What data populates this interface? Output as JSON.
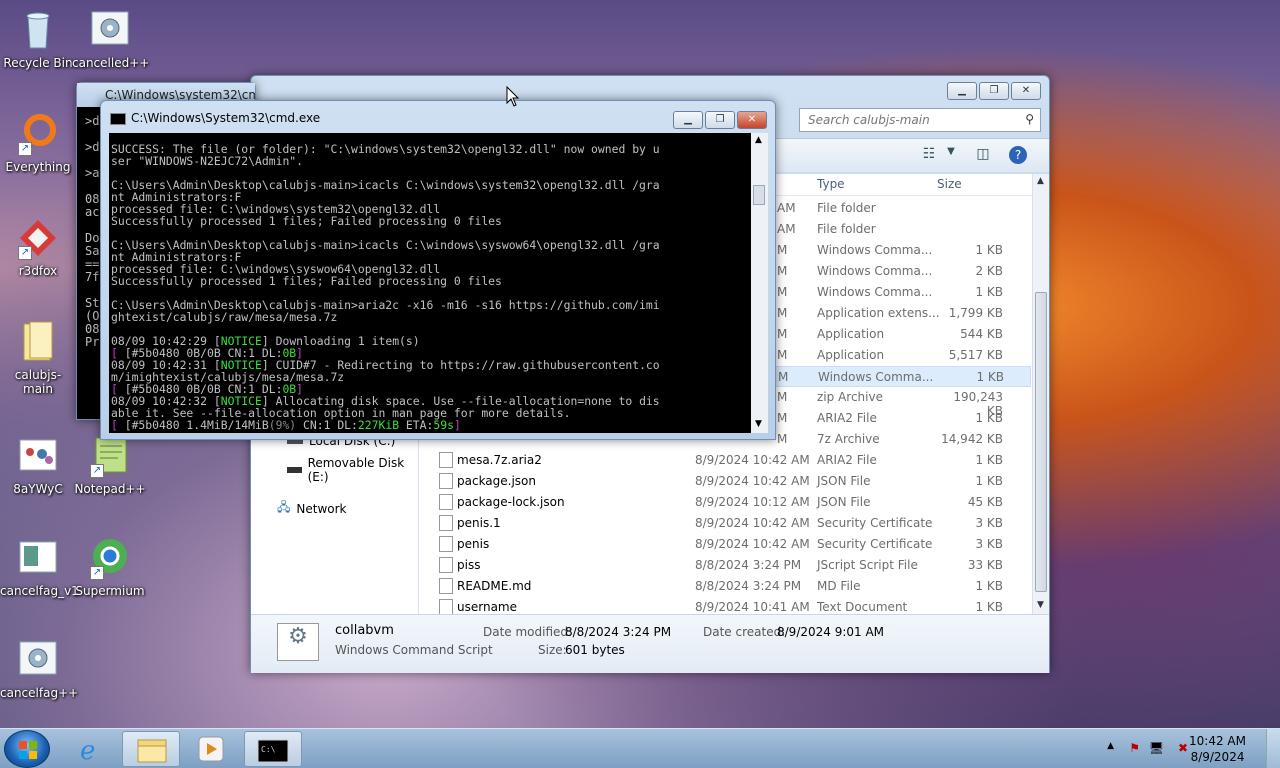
{
  "desktop": {
    "icons": [
      {
        "label": "Recycle Bin"
      },
      {
        "label": "cancelled++"
      },
      {
        "label": "Everything"
      },
      {
        "label": "r3dfox"
      },
      {
        "label": "calubjs-main"
      },
      {
        "label": "8aYWyC"
      },
      {
        "label": "Notepad++"
      },
      {
        "label": "cancelfag_v1"
      },
      {
        "label": "Supermium"
      },
      {
        "label": "cancelfag++"
      }
    ]
  },
  "cmd_back": {
    "title": "C:\\Windows\\system32\\cmd",
    "lines": [
      ">d",
      "",
      ">d",
      "",
      ">a",
      "",
      "08",
      "ac",
      "",
      "Do",
      "Sa",
      "==",
      "7f",
      "",
      "St",
      "(O",
      "08",
      "Pr"
    ]
  },
  "cmd_front": {
    "title": "C:\\Windows\\System32\\cmd.exe",
    "line1": "SUCCESS: The file (or folder): \"C:\\windows\\system32\\opengl32.dll\" now owned by u",
    "line2": "ser \"WINDOWS-N2EJC72\\Admin\".",
    "line3": "C:\\Users\\Admin\\Desktop\\calubjs-main>icacls C:\\windows\\system32\\opengl32.dll /gra",
    "line4": "nt Administrators:F",
    "line5": "processed file: C:\\windows\\system32\\opengl32.dll",
    "line6": "Successfully processed 1 files; Failed processing 0 files",
    "line7": "C:\\Users\\Admin\\Desktop\\calubjs-main>icacls C:\\windows\\syswow64\\opengl32.dll /gra",
    "line8": "nt Administrators:F",
    "line9": "processed file: C:\\windows\\syswow64\\opengl32.dll",
    "line10": "Successfully processed 1 files; Failed processing 0 files",
    "line11": "C:\\Users\\Admin\\Desktop\\calubjs-main>aria2c -x16 -m16 -s16 https://github.com/imi",
    "line12": "ghtexist/calubjs/raw/mesa/mesa.7z",
    "l13a": "08/09 10:42:29 [",
    "notice": "NOTICE",
    "l13b": "] Downloading 1 item(s)",
    "l14a": " [#5b0480 0B/0B CN:1 DL:",
    "l14b": "0B",
    "l14c": "]",
    "l15a": "08/09 10:42:31 [",
    "l15b": "] CUID#7 - Redirecting to https://raw.githubusercontent.co",
    "line16": "m/imightexist/calubjs/mesa/mesa.7z",
    "l17a": " [#5b0480 0B/0B CN:1 DL:",
    "l17b": "0B",
    "l17c": "]",
    "l18a": "08/09 10:42:32 [",
    "l18b": "] Allocating disk space. Use --file-allocation=none to dis",
    "line19": "able it. See --file-allocation option in man page for more details.",
    "l20a": " [#5b0480 1.4MiB/14MiB",
    "l20b": "(9%)",
    "l20c": " CN:1 DL:",
    "l20d": "227KiB",
    "l20e": " ETA:",
    "l20f": "59s",
    "l20g": "]"
  },
  "explorer": {
    "search_placeholder": "Search calubjs-main",
    "columns": {
      "type": "Type",
      "size": "Size"
    },
    "nav": {
      "local_disk": "Local Disk (C:)",
      "removable": "Removable Disk (E:)",
      "network": "Network"
    },
    "rows_partial": [
      {
        "type": "File folder",
        "size": "",
        "dt": "AM"
      },
      {
        "type": "File folder",
        "size": "",
        "dt": "AM"
      },
      {
        "type": "Windows Comma...",
        "size": "1 KB",
        "dt": "M"
      },
      {
        "type": "Windows Comma...",
        "size": "2 KB",
        "dt": "M"
      },
      {
        "type": "Windows Comma...",
        "size": "1 KB",
        "dt": "M"
      },
      {
        "type": "Application extens...",
        "size": "1,799 KB",
        "dt": "M"
      },
      {
        "type": "Application",
        "size": "544 KB",
        "dt": "M"
      },
      {
        "type": "Application",
        "size": "5,517 KB",
        "dt": "M"
      },
      {
        "type": "Windows Comma...",
        "size": "1 KB",
        "dt": "M"
      },
      {
        "type": "zip Archive",
        "size": "190,243 KB",
        "dt": "M"
      },
      {
        "type": "ARIA2 File",
        "size": "1 KB",
        "dt": "M"
      },
      {
        "type": "7z Archive",
        "size": "14,942 KB",
        "dt": "M"
      }
    ],
    "rows": [
      {
        "name": "mesa.7z.aria2",
        "date": "8/9/2024 10:42 AM",
        "type": "ARIA2 File",
        "size": "1 KB"
      },
      {
        "name": "package.json",
        "date": "8/9/2024 10:42 AM",
        "type": "JSON File",
        "size": "1 KB"
      },
      {
        "name": "package-lock.json",
        "date": "8/9/2024 10:12 AM",
        "type": "JSON File",
        "size": "45 KB"
      },
      {
        "name": "penis.1",
        "date": "8/9/2024 10:42 AM",
        "type": "Security Certificate",
        "size": "3 KB"
      },
      {
        "name": "penis",
        "date": "8/9/2024 10:42 AM",
        "type": "Security Certificate",
        "size": "3 KB"
      },
      {
        "name": "piss",
        "date": "8/8/2024 3:24 PM",
        "type": "JScript Script File",
        "size": "33 KB"
      },
      {
        "name": "README.md",
        "date": "8/8/2024 3:24 PM",
        "type": "MD File",
        "size": "1 KB"
      },
      {
        "name": "username",
        "date": "8/9/2024 10:41 AM",
        "type": "Text Document",
        "size": "1 KB"
      }
    ],
    "status": {
      "name": "collabvm",
      "kind": "Windows Command Script",
      "modified_label": "Date modified:",
      "modified": "8/8/2024 3:24 PM",
      "created_label": "Date created:",
      "created": "8/9/2024 9:01 AM",
      "size_label": "Size:",
      "size": "601 bytes"
    }
  },
  "taskbar": {
    "time": "10:42 AM",
    "date": "8/9/2024"
  }
}
